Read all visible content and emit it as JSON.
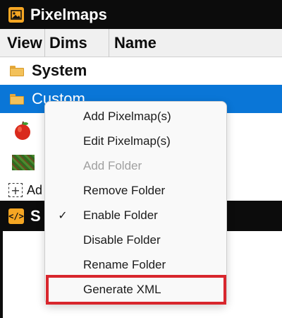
{
  "pixelmaps_panel": {
    "title": "Pixelmaps",
    "columns": [
      "View",
      "Dims",
      "Name"
    ],
    "folders": [
      "System",
      "Custom"
    ],
    "add_label": "Ad"
  },
  "source_panel": {
    "title": "S"
  },
  "context_menu": {
    "items": [
      {
        "label": "Add Pixelmap(s)",
        "enabled": true,
        "checked": false
      },
      {
        "label": "Edit Pixelmap(s)",
        "enabled": true,
        "checked": false
      },
      {
        "label": "Add Folder",
        "enabled": false,
        "checked": false
      },
      {
        "label": "Remove Folder",
        "enabled": true,
        "checked": false
      },
      {
        "label": "Enable Folder",
        "enabled": true,
        "checked": true
      },
      {
        "label": "Disable Folder",
        "enabled": true,
        "checked": false
      },
      {
        "label": "Rename Folder",
        "enabled": true,
        "checked": false
      },
      {
        "label": "Generate XML",
        "enabled": true,
        "checked": false,
        "highlighted": true
      }
    ],
    "check_glyph": "✓"
  },
  "colors": {
    "header_bg": "#0c0c0c",
    "accent_icon": "#f5a623",
    "selection": "#0a76d7",
    "highlight_box": "#d8262d"
  },
  "icons": [
    "image-icon",
    "folder-icon",
    "apple-icon",
    "grass-icon",
    "add-icon",
    "code-icon",
    "checkmark-icon"
  ]
}
